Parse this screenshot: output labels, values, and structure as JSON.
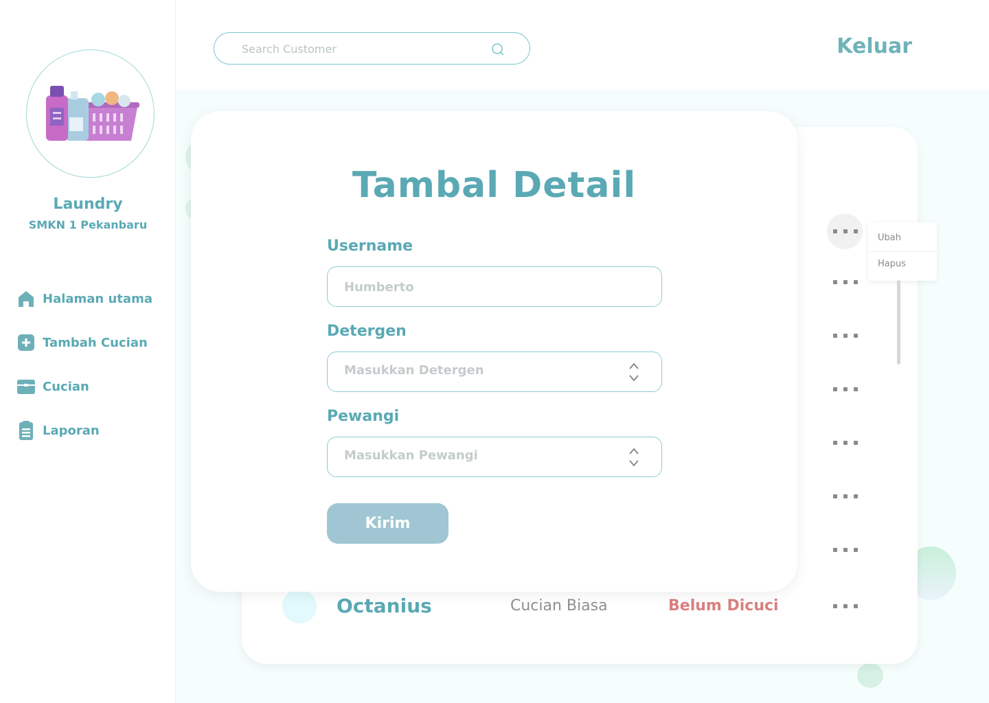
{
  "sidebar": {
    "brand_name": "Laundry",
    "brand_sub": "SMKN 1 Pekanbaru",
    "nav": [
      {
        "label": "Halaman utama",
        "icon": "home-icon"
      },
      {
        "label": "Tambah Cucian",
        "icon": "plus-square-icon"
      },
      {
        "label": "Cucian",
        "icon": "box-icon"
      },
      {
        "label": "Laporan",
        "icon": "clipboard-icon"
      }
    ]
  },
  "header": {
    "search_placeholder": "Search Customer",
    "logout_label": "Keluar"
  },
  "context_menu": {
    "edit_label": "Ubah",
    "delete_label": "Hapus"
  },
  "table": {
    "visible_row": {
      "name": "Octanius",
      "type": "Cucian Biasa",
      "status": "Belum Dicuci"
    }
  },
  "modal": {
    "title": "Tambal Detail",
    "username_label": "Username",
    "username_placeholder": "Humberto",
    "detergent_label": "Detergen",
    "detergent_placeholder": "Masukkan Detergen",
    "fragrance_label": "Pewangi",
    "fragrance_placeholder": "Masukkan Pewangi",
    "submit_label": "Kirim"
  },
  "colors": {
    "accent": "#5aa9b4",
    "status_red": "#d98080",
    "button": "#9fc6d2"
  }
}
